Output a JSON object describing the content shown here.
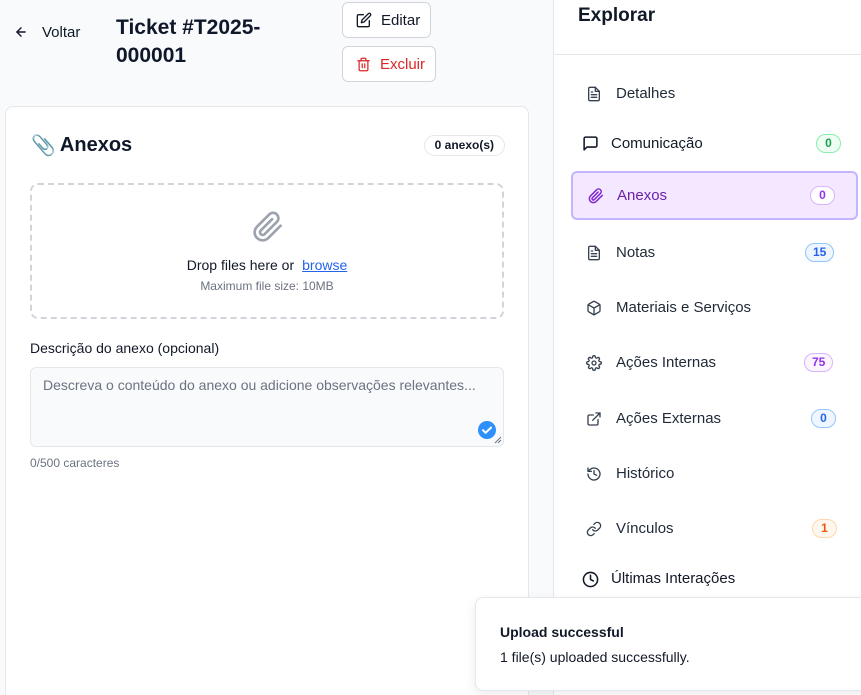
{
  "header": {
    "back_label": "Voltar",
    "ticket_title": "Ticket #T2025-000001",
    "edit_label": "Editar",
    "delete_label": "Excluir"
  },
  "attachments": {
    "title": "Anexos",
    "title_emoji": "📎",
    "count_label": "0 anexo(s)",
    "drop_text": "Drop files here or",
    "browse_link": "browse",
    "max_size": "Maximum file size: 10MB",
    "description_label": "Descrição do anexo (opcional)",
    "description_placeholder": "Descreva o conteúdo do anexo ou adicione observações relevantes...",
    "description_value": "",
    "char_count": "0/500 caracteres"
  },
  "sidebar": {
    "title": "Explorar",
    "items": [
      {
        "label": "Detalhes",
        "icon": "file-text-icon",
        "badge": null
      },
      {
        "label": "Comunicação",
        "icon": "message-square-icon",
        "badge": "0",
        "badge_color": "#16a34a"
      },
      {
        "label": "Anexos",
        "icon": "paperclip-icon",
        "badge": "0",
        "badge_color": "#9333ea",
        "active": true
      },
      {
        "label": "Notas",
        "icon": "file-text-icon",
        "badge": "15",
        "badge_color": "#2563eb"
      },
      {
        "label": "Materiais e Serviços",
        "icon": "package-icon",
        "badge": null
      },
      {
        "label": "Ações Internas",
        "icon": "gear-icon",
        "badge": "75",
        "badge_color": "#9333ea"
      },
      {
        "label": "Ações Externas",
        "icon": "external-link-icon",
        "badge": "0",
        "badge_color": "#2563eb"
      },
      {
        "label": "Histórico",
        "icon": "history-icon",
        "badge": null
      },
      {
        "label": "Vínculos",
        "icon": "link-icon",
        "badge": "1",
        "badge_color": "#ea580c"
      },
      {
        "label": "Últimas Interações",
        "icon": "clock-icon",
        "badge": null
      }
    ]
  },
  "toast": {
    "title": "Upload successful",
    "message": "1 file(s) uploaded successfully."
  },
  "colors": {
    "accent": "#9333ea",
    "danger": "#dc2626",
    "link": "#2563eb"
  }
}
